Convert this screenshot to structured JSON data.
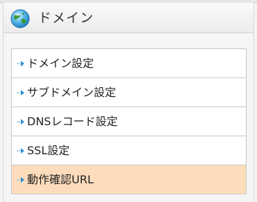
{
  "header": {
    "title": "ドメイン",
    "icon": "globe-icon"
  },
  "menu": {
    "items": [
      {
        "label": "ドメイン設定",
        "icon": "arrow-right-icon",
        "active": false
      },
      {
        "label": "サブドメイン設定",
        "icon": "arrow-right-icon",
        "active": false
      },
      {
        "label": "DNSレコード設定",
        "icon": "arrow-right-icon",
        "active": false
      },
      {
        "label": "SSL設定",
        "icon": "arrow-right-icon",
        "active": false
      },
      {
        "label": "動作確認URL",
        "icon": "arrow-right-icon",
        "active": true
      }
    ]
  },
  "colors": {
    "active_background": "#fcdcbb",
    "arrow_blue": "#2b8fd6",
    "panel_background": "#f5f5f5"
  }
}
